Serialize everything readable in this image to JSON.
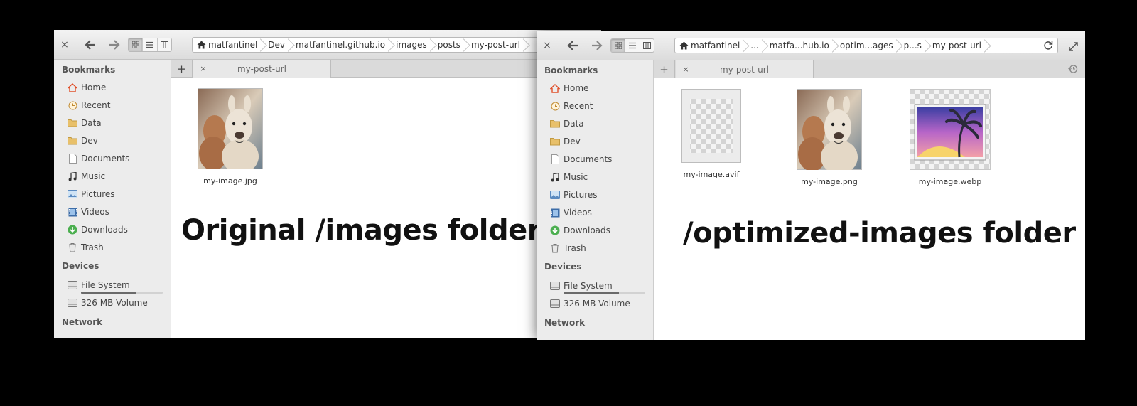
{
  "icons": {
    "close": "close-icon",
    "back": "back-arrow-icon",
    "forward": "forward-arrow-icon",
    "grid": "icon-view-icon",
    "list": "list-view-icon",
    "columns": "column-view-icon",
    "home": "home-icon",
    "reload": "reload-icon",
    "expand": "expand-icon",
    "history": "history-icon"
  },
  "colors": {
    "background": "#000000",
    "sidebar": "#ececec",
    "titlebar": "#e4e4e4",
    "downloads": "#4caf50",
    "home": "#e0502a",
    "folder": "#e8c06a"
  },
  "left_window": {
    "close_label": "×",
    "path": [
      "matfantinel",
      "Dev",
      "matfantinel.github.io",
      "images",
      "posts",
      "my-post-url"
    ],
    "sidebar": {
      "bookmarks_title": "Bookmarks",
      "bookmarks": [
        "Home",
        "Recent",
        "Data",
        "Dev",
        "Documents",
        "Music",
        "Pictures",
        "Videos",
        "Downloads",
        "Trash"
      ],
      "devices_title": "Devices",
      "devices": [
        "File System",
        "326 MB Volume"
      ],
      "network_title": "Network"
    },
    "tab": {
      "add_label": "+",
      "close_label": "×",
      "label": "my-post-url"
    },
    "files": [
      "my-image.jpg"
    ],
    "caption": "Original /images folder"
  },
  "right_window": {
    "close_label": "×",
    "path": [
      "matfantinel",
      "...",
      "matfa...hub.io",
      "optim...ages",
      "p...s",
      "my-post-url"
    ],
    "sidebar": {
      "bookmarks_title": "Bookmarks",
      "bookmarks": [
        "Home",
        "Recent",
        "Data",
        "Dev",
        "Documents",
        "Music",
        "Pictures",
        "Videos",
        "Downloads",
        "Trash"
      ],
      "devices_title": "Devices",
      "devices": [
        "File System",
        "326 MB Volume"
      ],
      "network_title": "Network"
    },
    "tab": {
      "add_label": "+",
      "close_label": "×",
      "label": "my-post-url"
    },
    "files": [
      "my-image.avif",
      "my-image.png",
      "my-image.webp"
    ],
    "caption": "/optimized-images folder"
  },
  "file_system_usage": 0.68
}
